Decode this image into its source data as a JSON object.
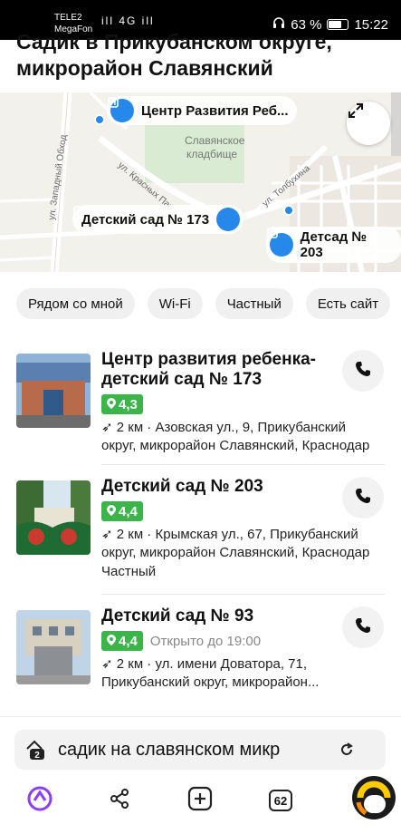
{
  "status_bar": {
    "carrier1": "TELE2",
    "carrier2": "MegaFon",
    "network_icons": "ill 4G ill",
    "battery": "63 %",
    "time": "15:22"
  },
  "page": {
    "title": "Садик в Прикубанском округе, микрорайон Славянский"
  },
  "map": {
    "pins": [
      {
        "label": "Центр Развития Реб..."
      },
      {
        "label": "Детский сад № 173"
      },
      {
        "label": "Детсад № 203"
      }
    ],
    "streets": [
      "ул. Западный Обход",
      "ул. Красных Пар...",
      "ул. Толбухина"
    ],
    "place": "Славянское кладбище",
    "accent": "#2688eb"
  },
  "filters": [
    "Рядом со мной",
    "Wi-Fi",
    "Частный",
    "Есть сайт"
  ],
  "results": [
    {
      "name": "Центр развития ребенка-детский сад № 173",
      "rating": "4,3",
      "open": "",
      "distance": "2 км",
      "address": "Азовская ул., 9, Прикубанский округ, микрорайон Славянский, Краснодар",
      "extra": ""
    },
    {
      "name": "Детский сад № 203",
      "rating": "4,4",
      "open": "",
      "distance": "2 км",
      "address": "Крымская ул., 67, Прикубанский округ, микрорайон Славянский, Краснодар",
      "extra": "Частный"
    },
    {
      "name": "Детский сад № 93",
      "rating": "4,4",
      "open": "Открыто до 19:00",
      "distance": "2 км",
      "address": "ул. имени Доватора, 71, Прикубанский округ, микрорайон...",
      "extra": ""
    }
  ],
  "search": {
    "query": "садик на славянском микр",
    "tabs_badge": "2"
  },
  "nav": {
    "tab_count": "62"
  },
  "colors": {
    "rating_green": "#3bb54a",
    "alice_purple": "#8a3ffc"
  }
}
